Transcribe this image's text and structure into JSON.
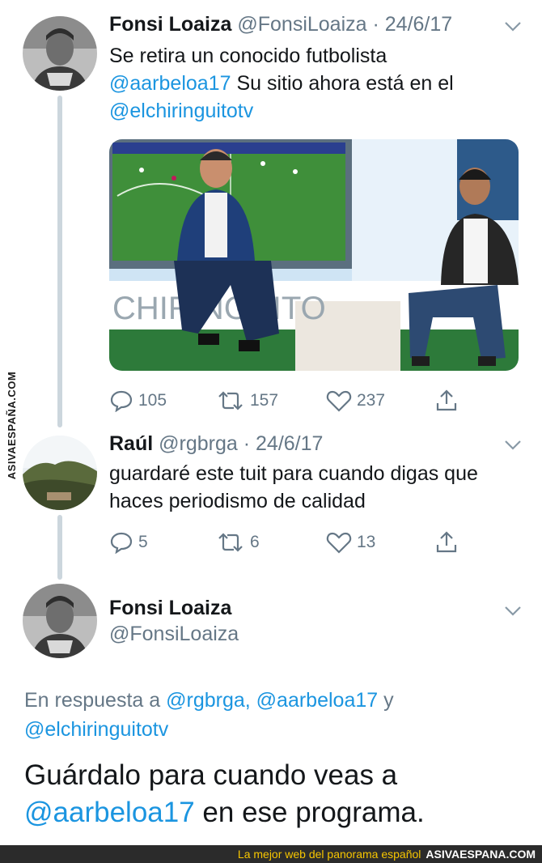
{
  "tweet1": {
    "name": "Fonsi Loaiza",
    "handle": "@FonsiLoaiza",
    "date": "· 24/6/17",
    "text_a": "Se retira un conocido futbolista",
    "mention_a": "@aarbeloa17",
    "text_b": " Su sitio ahora está en el",
    "mention_b": "@elchiringuitotv",
    "media_text": "CHIRINGUITO",
    "replies": "105",
    "retweets": "157",
    "likes": "237"
  },
  "tweet2": {
    "name": "Raúl",
    "handle": "@rgbrga",
    "date": "· 24/6/17",
    "text_a": "guardaré este tuit para cuando digas que",
    "text_b": "haces periodismo de calidad",
    "replies": "5",
    "retweets": "6",
    "likes": "13"
  },
  "tweet3": {
    "name": "Fonsi Loaiza",
    "handle": "@FonsiLoaiza",
    "reply_prefix": "En respuesta a",
    "reply_mention_1": "@rgbrga,",
    "reply_mention_2": "@aarbeloa17",
    "reply_and": "y",
    "reply_mention_3": "@elchiringuitotv",
    "text_a": "Guárdalo para cuando veas a",
    "mention": "@aarbeloa17",
    "text_b": " en ese programa."
  },
  "watermark": "ASIVAESPAÑA.COM",
  "footer": {
    "tagline": "La mejor web del panorama español",
    "brand": "ASIVAESPANA.COM"
  },
  "colors": {
    "link": "#1b95e0",
    "meta": "#657786",
    "thread_line": "#ccd6dd"
  }
}
